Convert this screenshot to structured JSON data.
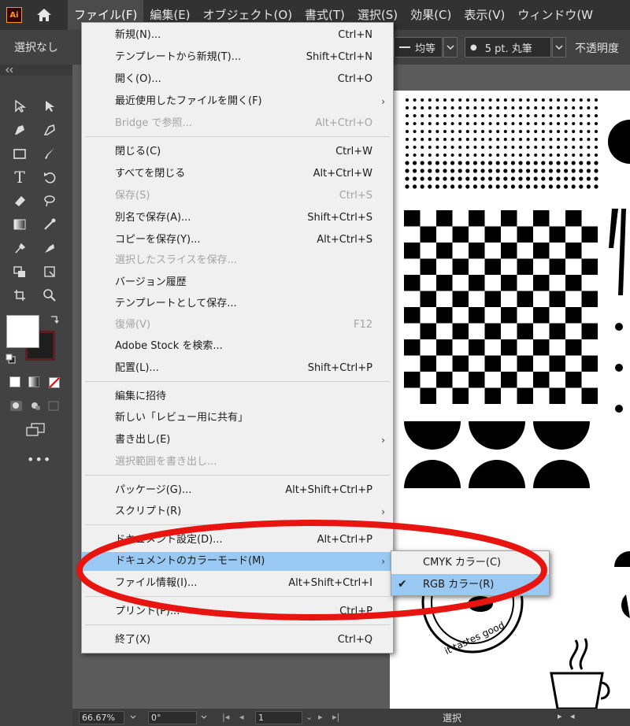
{
  "app": {
    "logo_text": "Ai",
    "menus": [
      "ファイル(F)",
      "編集(E)",
      "オブジェクト(O)",
      "書式(T)",
      "選択(S)",
      "効果(C)",
      "表示(V)",
      "ウィンドウ(W"
    ]
  },
  "controlbar": {
    "selection": "選択なし",
    "stroke_profile": "均等",
    "brush": "5 pt. 丸筆",
    "opacity_label": "不透明度"
  },
  "file_menu": {
    "items": [
      {
        "label": "新規(N)...",
        "shortcut": "Ctrl+N"
      },
      {
        "label": "テンプレートから新規(T)...",
        "shortcut": "Shift+Ctrl+N"
      },
      {
        "label": "開く(O)...",
        "shortcut": "Ctrl+O"
      },
      {
        "label": "最近使用したファイルを開く(F)",
        "shortcut": ""
      },
      {
        "label": "Bridge で参照...",
        "shortcut": "Alt+Ctrl+O"
      },
      {
        "label": "閉じる(C)",
        "shortcut": "Ctrl+W"
      },
      {
        "label": "すべてを閉じる",
        "shortcut": "Alt+Ctrl+W"
      },
      {
        "label": "保存(S)",
        "shortcut": "Ctrl+S"
      },
      {
        "label": "別名で保存(A)...",
        "shortcut": "Shift+Ctrl+S"
      },
      {
        "label": "コピーを保存(Y)...",
        "shortcut": "Alt+Ctrl+S"
      },
      {
        "label": "選択したスライスを保存...",
        "shortcut": ""
      },
      {
        "label": "バージョン履歴",
        "shortcut": ""
      },
      {
        "label": "テンプレートとして保存...",
        "shortcut": ""
      },
      {
        "label": "復帰(V)",
        "shortcut": "F12"
      },
      {
        "label": "Adobe Stock を検索...",
        "shortcut": ""
      },
      {
        "label": "配置(L)...",
        "shortcut": "Shift+Ctrl+P"
      },
      {
        "label": "編集に招待",
        "shortcut": ""
      },
      {
        "label": "新しい「レビュー用に共有」",
        "shortcut": ""
      },
      {
        "label": "書き出し(E)",
        "shortcut": ""
      },
      {
        "label": "選択範囲を書き出し...",
        "shortcut": ""
      },
      {
        "label": "パッケージ(G)...",
        "shortcut": "Alt+Shift+Ctrl+P"
      },
      {
        "label": "スクリプト(R)",
        "shortcut": ""
      },
      {
        "label": "ドキュメント設定(D)...",
        "shortcut": "Alt+Ctrl+P"
      },
      {
        "label": "ドキュメントのカラーモード(M)",
        "shortcut": ""
      },
      {
        "label": "ファイル情報(I)...",
        "shortcut": "Alt+Shift+Ctrl+I"
      },
      {
        "label": "プリント(P)...",
        "shortcut": "Ctrl+P"
      },
      {
        "label": "終了(X)",
        "shortcut": "Ctrl+Q"
      }
    ]
  },
  "color_mode_submenu": {
    "items": [
      {
        "label": "CMYK カラー(C)",
        "checked": false
      },
      {
        "label": "RGB カラー(R)",
        "checked": true
      }
    ]
  },
  "statusbar": {
    "zoom": "66.67%",
    "rotation": "0°",
    "artboard": "1",
    "tool": "選択"
  },
  "artwork": {
    "stamp_text": "it tastes good"
  },
  "colors": {
    "highlight": "#99c9f2",
    "annotation": "#e8140f",
    "menu_bg": "#f0f0f0",
    "app_bg": "#535353"
  }
}
